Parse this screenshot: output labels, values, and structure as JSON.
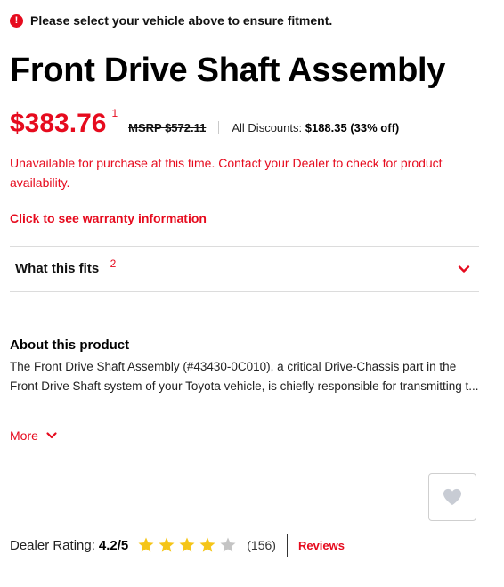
{
  "alert": {
    "icon": "!",
    "text": "Please select your vehicle above to ensure fitment."
  },
  "product": {
    "title": "Front Drive Shaft Assembly",
    "price": "$383.76",
    "price_footnote": "1",
    "msrp": "MSRP $572.11",
    "discount_label": "All Discounts:",
    "discount_value": "$188.35 (33% off)",
    "unavailable": "Unavailable for purchase at this time. Contact your Dealer to check for product availability.",
    "warranty_link": "Click to see warranty information"
  },
  "fits": {
    "label": "What this fits",
    "footnote": "2",
    "icon": "chevron-down-icon"
  },
  "about": {
    "heading": "About this product",
    "text": "The Front Drive Shaft Assembly (#43430-0C010), a critical Drive-Chassis part in the Front Drive Shaft system of your Toyota vehicle, is chiefly responsible for transmitting t...",
    "more_label": "More"
  },
  "rating": {
    "label": "Dealer Rating:",
    "value": "4.2/5",
    "stars_filled": 4,
    "stars_total": 5,
    "count": "(156)",
    "reviews_link": "Reviews"
  },
  "colors": {
    "accent": "#e60b1e",
    "star": "#f5c518",
    "star_empty": "#c4c4c4"
  }
}
